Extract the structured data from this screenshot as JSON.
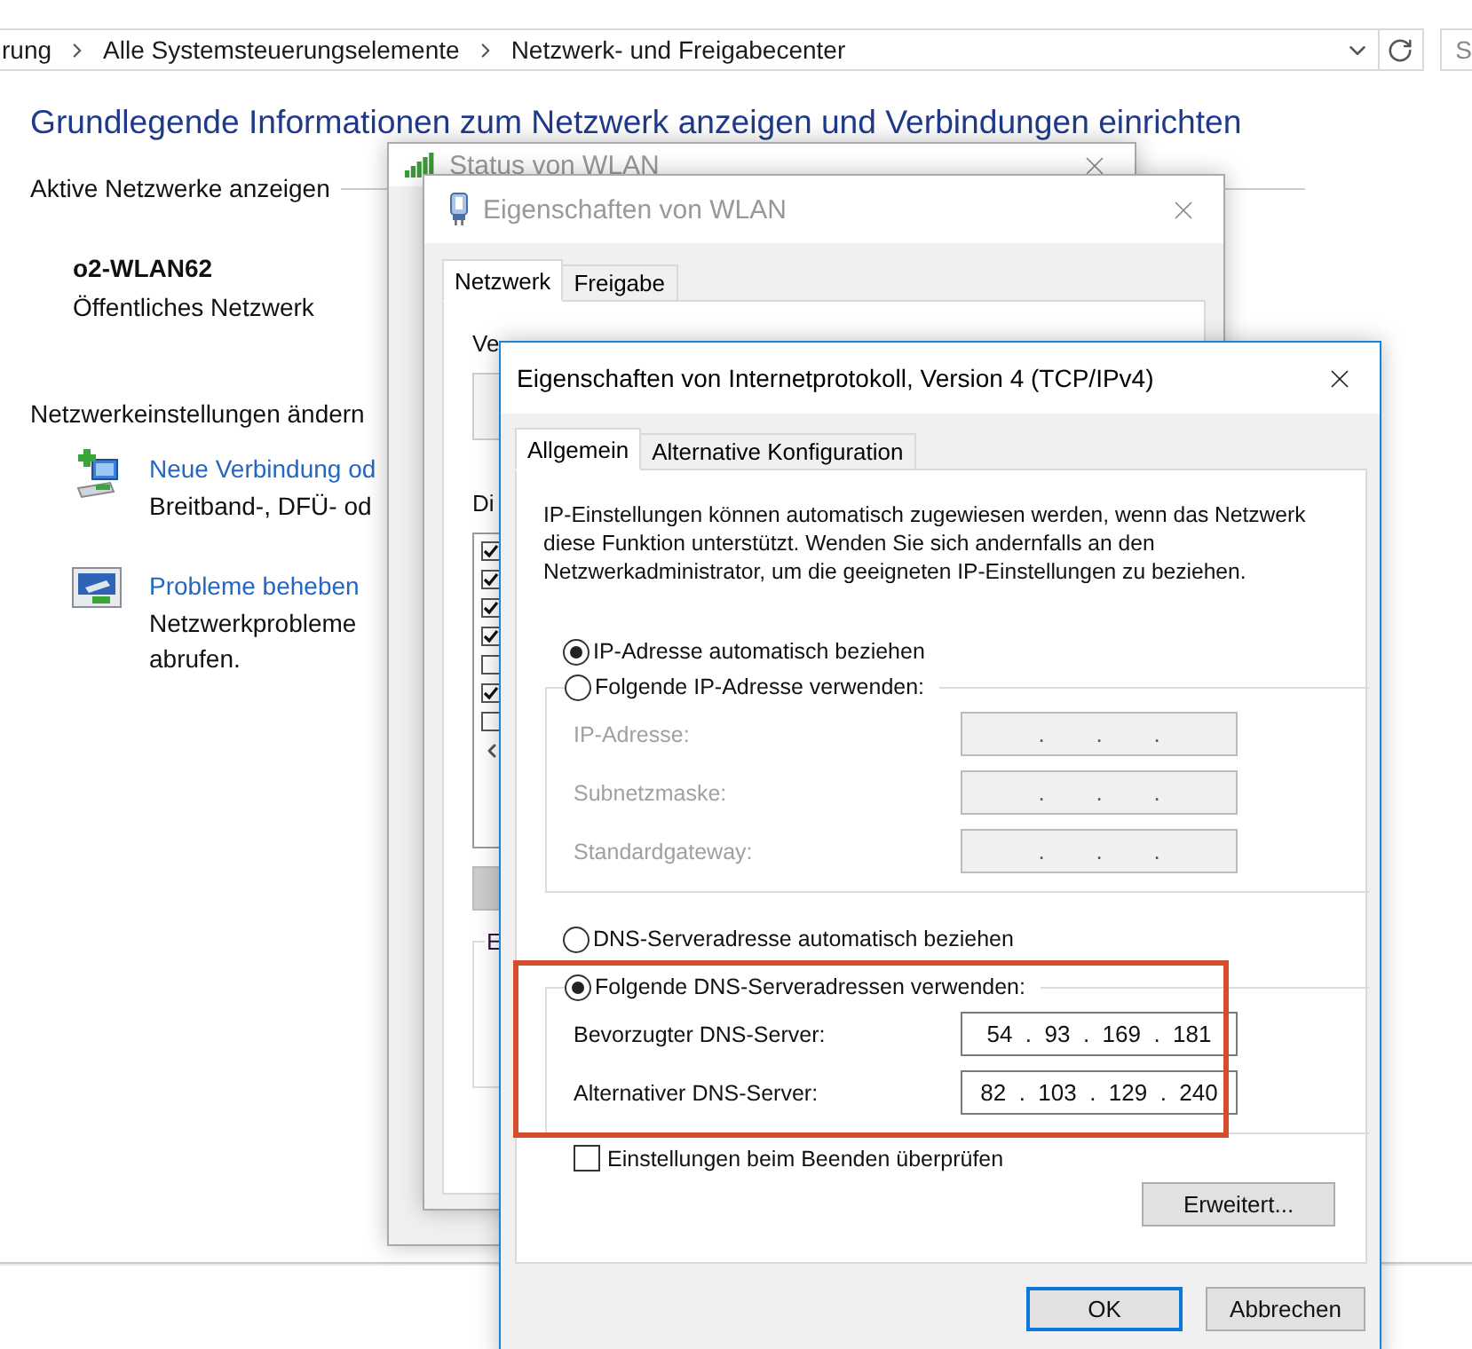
{
  "address_bar": {
    "crumbs": [
      "rung",
      "Alle Systemsteuerungselemente",
      "Netzwerk- und Freigabecenter"
    ],
    "search_placeholder": "S"
  },
  "page": {
    "heading": "Grundlegende Informationen zum Netzwerk anzeigen und Verbindungen einrichten",
    "active_networks_label": "Aktive Netzwerke anzeigen",
    "network": {
      "name": "o2-WLAN62",
      "type": "Öffentliches Netzwerk"
    },
    "settings_label": "Netzwerkeinstellungen ändern",
    "tasks": [
      {
        "kind": "new_connection",
        "link": "Neue Verbindung od",
        "description": [
          "Breitband-, DFÜ- od"
        ]
      },
      {
        "kind": "troubleshoot",
        "link": "Probleme beheben",
        "description": [
          "Netzwerkprobleme",
          "abrufen."
        ]
      }
    ]
  },
  "status_window": {
    "title": "Status von WLAN"
  },
  "wlan_window": {
    "title": "Eigenschaften von WLAN",
    "tabs": [
      {
        "label": "Netzwerk",
        "selected": true
      },
      {
        "label": "Freigabe",
        "selected": false
      }
    ],
    "connect_label": "Ve",
    "components_label": "Di",
    "components": [
      {
        "checked": true
      },
      {
        "checked": true
      },
      {
        "checked": true
      },
      {
        "checked": true
      },
      {
        "checked": false
      },
      {
        "checked": true
      },
      {
        "checked": false
      }
    ],
    "group_label": "E"
  },
  "ipv4_dialog": {
    "title": "Eigenschaften von Internetprotokoll, Version 4 (TCP/IPv4)",
    "tabs": [
      {
        "label": "Allgemein",
        "selected": true
      },
      {
        "label": "Alternative Konfiguration",
        "selected": false
      }
    ],
    "description": "IP-Einstellungen können automatisch zugewiesen werden, wenn das Netzwerk diese Funktion unterstützt. Wenden Sie sich andernfalls an den Netzwerkadministrator, um die geeigneten IP-Einstellungen zu beziehen.",
    "ip_options": [
      {
        "label": "IP-Adresse automatisch beziehen",
        "selected": true
      },
      {
        "label": "Folgende IP-Adresse verwenden:",
        "selected": false
      }
    ],
    "ip_fields": [
      {
        "label": "IP-Adresse:",
        "value": ".        .        .",
        "disabled": true
      },
      {
        "label": "Subnetzmaske:",
        "value": ".        .        .",
        "disabled": true
      },
      {
        "label": "Standardgateway:",
        "value": ".        .        .",
        "disabled": true
      }
    ],
    "dns_options": [
      {
        "label": "DNS-Serveradresse automatisch beziehen",
        "selected": false
      },
      {
        "label": "Folgende DNS-Serveradressen verwenden:",
        "selected": true
      }
    ],
    "dns_fields": [
      {
        "label": "Bevorzugter DNS-Server:",
        "value": "54  .  93  .  169  .  181",
        "disabled": false
      },
      {
        "label": "Alternativer DNS-Server:",
        "value": "82  .  103  .  129  .  240",
        "disabled": false
      }
    ],
    "dns_highlighted": true,
    "validate_on_exit": {
      "label": "Einstellungen beim Beenden überprüfen",
      "checked": false
    },
    "advanced_button": "Erweitert...",
    "buttons": [
      {
        "label": "OK",
        "default": true
      },
      {
        "label": "Abbrechen",
        "default": false
      }
    ]
  }
}
